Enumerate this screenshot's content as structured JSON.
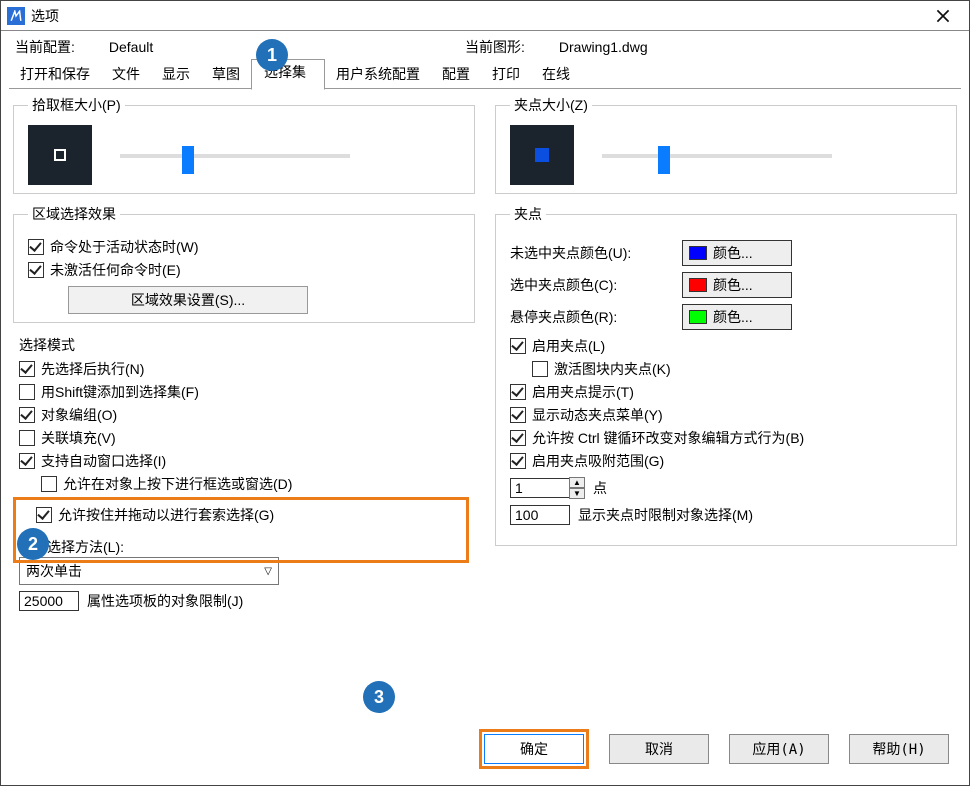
{
  "window": {
    "title": "选项"
  },
  "header": {
    "config_label": "当前配置:",
    "config_value": "Default",
    "drawing_label": "当前图形:",
    "drawing_value": "Drawing1.dwg"
  },
  "tabs": [
    "打开和保存",
    "文件",
    "显示",
    "草图",
    "选择集",
    "用户系统配置",
    "配置",
    "打印",
    "在线"
  ],
  "active_tab_index": 4,
  "left": {
    "pickbox_title": "拾取框大小(P)",
    "region_title": "区域选择效果",
    "region_items": {
      "active_cmd": "命令处于活动状态时(W)",
      "no_cmd": "未激活任何命令时(E)"
    },
    "region_btn": "区域效果设置(S)...",
    "selmode_title": "选择模式",
    "selmode_items": {
      "noun_verb": "先选择后执行(N)",
      "shift_add": "用Shift键添加到选择集(F)",
      "obj_group": "对象编组(O)",
      "assoc_hatch": "关联填充(V)",
      "imp_window": "支持自动窗口选择(I)",
      "press_drag": "允许在对象上按下进行框选或窗选(D)",
      "lasso": "允许按住并拖动以进行套索选择(G)"
    },
    "win_method_label": "窗口选择方法(L):",
    "win_method_value": "两次单击",
    "obj_limit_value": "25000",
    "obj_limit_label": "属性选项板的对象限制(J)"
  },
  "right": {
    "gripsize_title": "夹点大小(Z)",
    "grip_title": "夹点",
    "color_unselected": "未选中夹点颜色(U):",
    "color_selected": "选中夹点颜色(C):",
    "color_hover": "悬停夹点颜色(R):",
    "color_btn": "颜色...",
    "enable_grips": "启用夹点(L)",
    "grips_in_block": "激活图块内夹点(K)",
    "grip_tips": "启用夹点提示(T)",
    "dyn_menu": "显示动态夹点菜单(Y)",
    "ctrl_cycle": "允许按 Ctrl 键循环改变对象编辑方式行为(B)",
    "grip_snap": "启用夹点吸附范围(G)",
    "pt_value": "1",
    "pt_label": "点",
    "limit_value": "100",
    "limit_label": "显示夹点时限制对象选择(M)"
  },
  "colors": {
    "unselected": "#0000ff",
    "selected": "#ff0000",
    "hover": "#00ff00"
  },
  "buttons": {
    "ok": "确定",
    "cancel": "取消",
    "apply": "应用(A)",
    "help": "帮助(H)"
  },
  "callouts": {
    "one": "1",
    "two": "2",
    "three": "3"
  }
}
